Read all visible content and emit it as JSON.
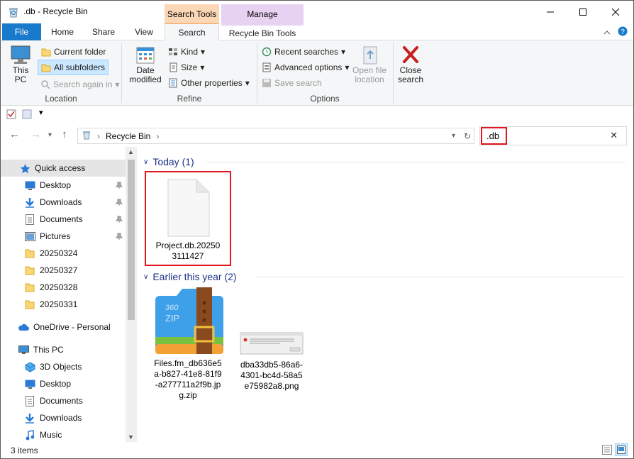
{
  "window": {
    "title": ".db - Recycle Bin",
    "minimize_icon": "minimize-icon",
    "maximize_icon": "maximize-icon",
    "close_icon": "close-icon"
  },
  "contextual_headers": {
    "search_tools": "Search Tools",
    "manage": "Manage"
  },
  "tabs": {
    "file": "File",
    "home": "Home",
    "share": "Share",
    "view": "View",
    "search": "Search",
    "recycle_bin_tools": "Recycle Bin Tools"
  },
  "ribbon": {
    "location": {
      "label": "Location",
      "this_pc": "This PC",
      "current_folder": "Current folder",
      "all_subfolders": "All subfolders",
      "search_again_in": "Search again in"
    },
    "refine": {
      "label": "Refine",
      "date_modified": "Date modified",
      "kind": "Kind",
      "size": "Size",
      "other_properties": "Other properties"
    },
    "options": {
      "label": "Options",
      "recent_searches": "Recent searches",
      "advanced_options": "Advanced options",
      "save_search": "Save search",
      "open_file_location": "Open file location"
    },
    "close_search": "Close search"
  },
  "address": {
    "path": "Recycle Bin"
  },
  "search": {
    "query": ".db"
  },
  "nav": {
    "quick_access": "Quick access",
    "items": [
      {
        "label": "Desktop"
      },
      {
        "label": "Downloads"
      },
      {
        "label": "Documents"
      },
      {
        "label": "Pictures"
      },
      {
        "label": "20250324"
      },
      {
        "label": "20250327"
      },
      {
        "label": "20250328"
      },
      {
        "label": "20250331"
      }
    ],
    "onedrive": "OneDrive - Personal",
    "this_pc": "This PC",
    "pc_items": [
      {
        "label": "3D Objects"
      },
      {
        "label": "Desktop"
      },
      {
        "label": "Documents"
      },
      {
        "label": "Downloads"
      },
      {
        "label": "Music"
      }
    ]
  },
  "content": {
    "groups": [
      {
        "header": "Today (1)",
        "files": [
          {
            "name": "Project.db.202503111427"
          }
        ]
      },
      {
        "header": "Earlier this year (2)",
        "files": [
          {
            "name": "Files.fm_db636e5a-b827-41e8-81f9-a277711a2f9b.jpg.zip"
          },
          {
            "name": "dba33db5-86a6-4301-bc4d-58a5e75982a8.png"
          }
        ]
      }
    ]
  },
  "status": {
    "items_count": "3 items"
  },
  "colors": {
    "file_tab": "#1979ca",
    "search_tools": "#fbd7b6",
    "manage": "#e8d2f2",
    "highlight": "#e0171d",
    "group_header": "#1e3287"
  }
}
